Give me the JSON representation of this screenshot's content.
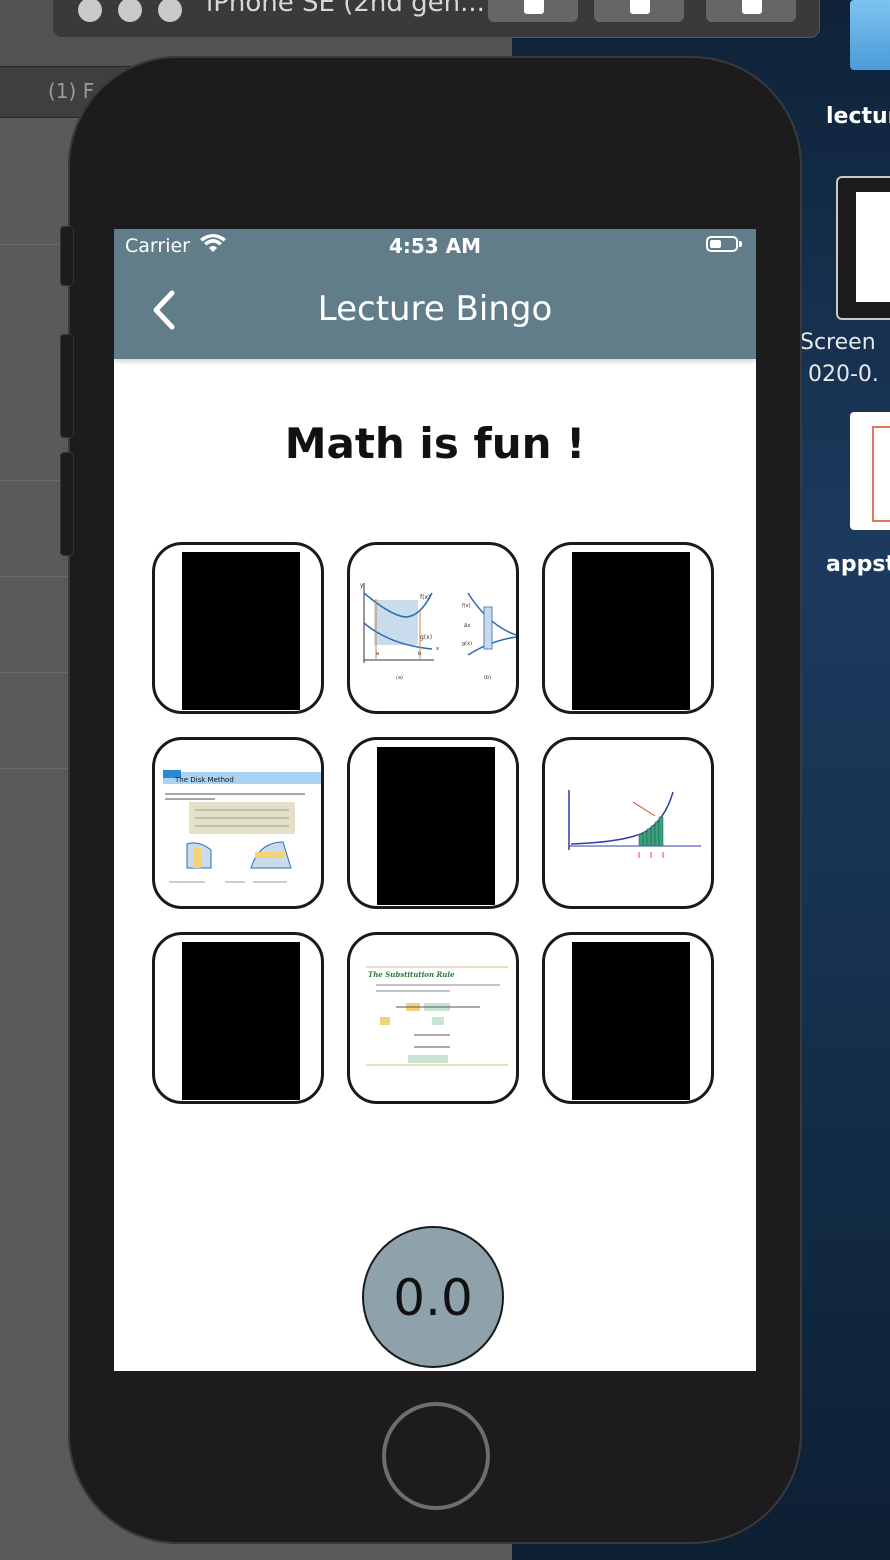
{
  "mac": {
    "left_tab_label": "(1) F",
    "simulator_title": "iPhone SE (2nd gen...",
    "desktop_labels": [
      "lectur",
      "Screen",
      "020-0.",
      "appst"
    ]
  },
  "status": {
    "carrier": "Carrier",
    "time": "4:53 AM"
  },
  "nav": {
    "title": "Lecture Bingo",
    "back_icon": "chevron-left-icon"
  },
  "heading": "Math is fun !",
  "tiles": [
    {
      "state": "hidden"
    },
    {
      "state": "revealed",
      "image": "area-between-curves-figure",
      "labels": [
        "y",
        "f(x)",
        "g(x)",
        "a",
        "b",
        "x",
        "(a)",
        "(b)",
        "f(x)",
        "Δx",
        "g(x)"
      ]
    },
    {
      "state": "hidden"
    },
    {
      "state": "revealed",
      "image": "disk-method-slide",
      "labels": [
        "The Disk Method"
      ]
    },
    {
      "state": "hidden"
    },
    {
      "state": "revealed",
      "image": "riemann-sum-curve-figure",
      "labels": []
    },
    {
      "state": "hidden"
    },
    {
      "state": "revealed",
      "image": "substitution-rule-slide",
      "labels": [
        "The Substitution Rule"
      ]
    },
    {
      "state": "hidden"
    }
  ],
  "score": {
    "value": "0.0"
  },
  "colors": {
    "nav": "#627d8a",
    "score_bg": "#8fa1ab"
  }
}
